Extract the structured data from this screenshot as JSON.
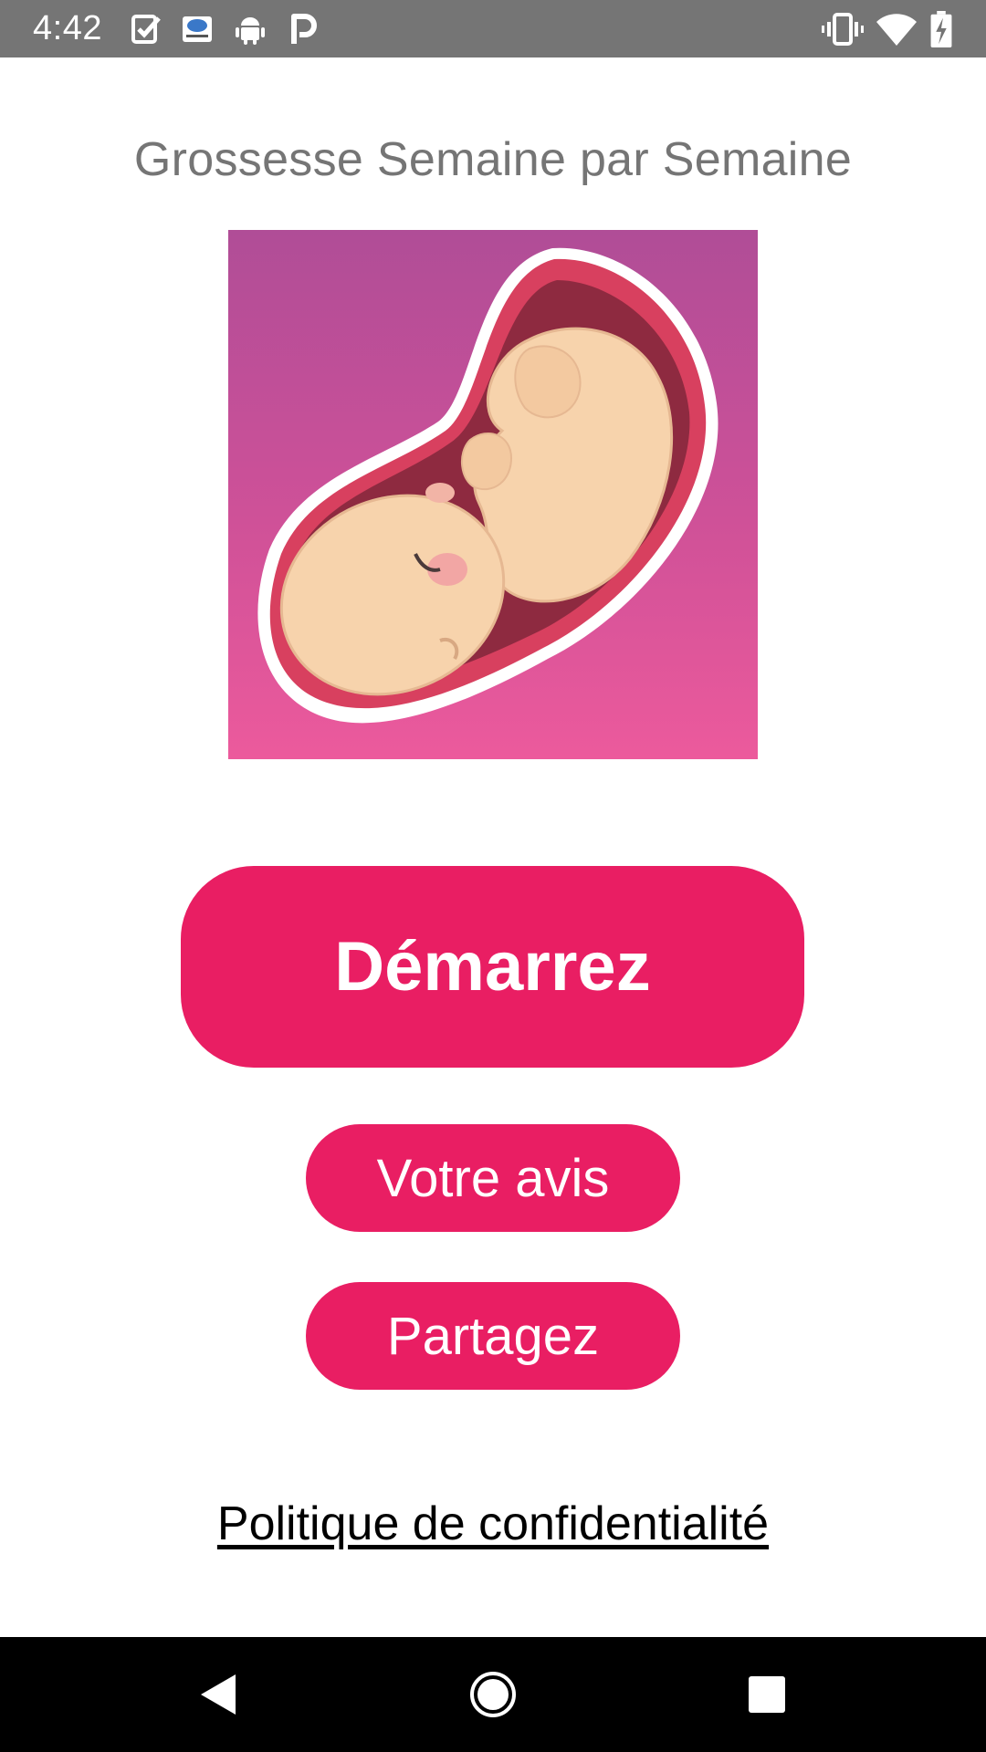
{
  "status_bar": {
    "time": "4:42",
    "left_icons": [
      "task-check-icon",
      "cloud-app-icon",
      "android-icon",
      "parking-app-icon"
    ],
    "right_icons": [
      "vibrate-icon",
      "wifi-icon",
      "battery-charging-icon"
    ]
  },
  "app": {
    "title": "Grossesse Semaine par Semaine",
    "hero_image": "fetus-in-womb-illustration"
  },
  "buttons": {
    "start_label": "Démarrez",
    "feedback_label": "Votre avis",
    "share_label": "Partagez"
  },
  "links": {
    "privacy_label": "Politique de confidentialité"
  },
  "nav_bar": {
    "icons": [
      "back-icon",
      "home-icon",
      "recents-icon"
    ]
  },
  "colors": {
    "accent": "#e91e63",
    "status_bar": "#757575",
    "title_text": "#757575",
    "nav_bar": "#000000"
  }
}
